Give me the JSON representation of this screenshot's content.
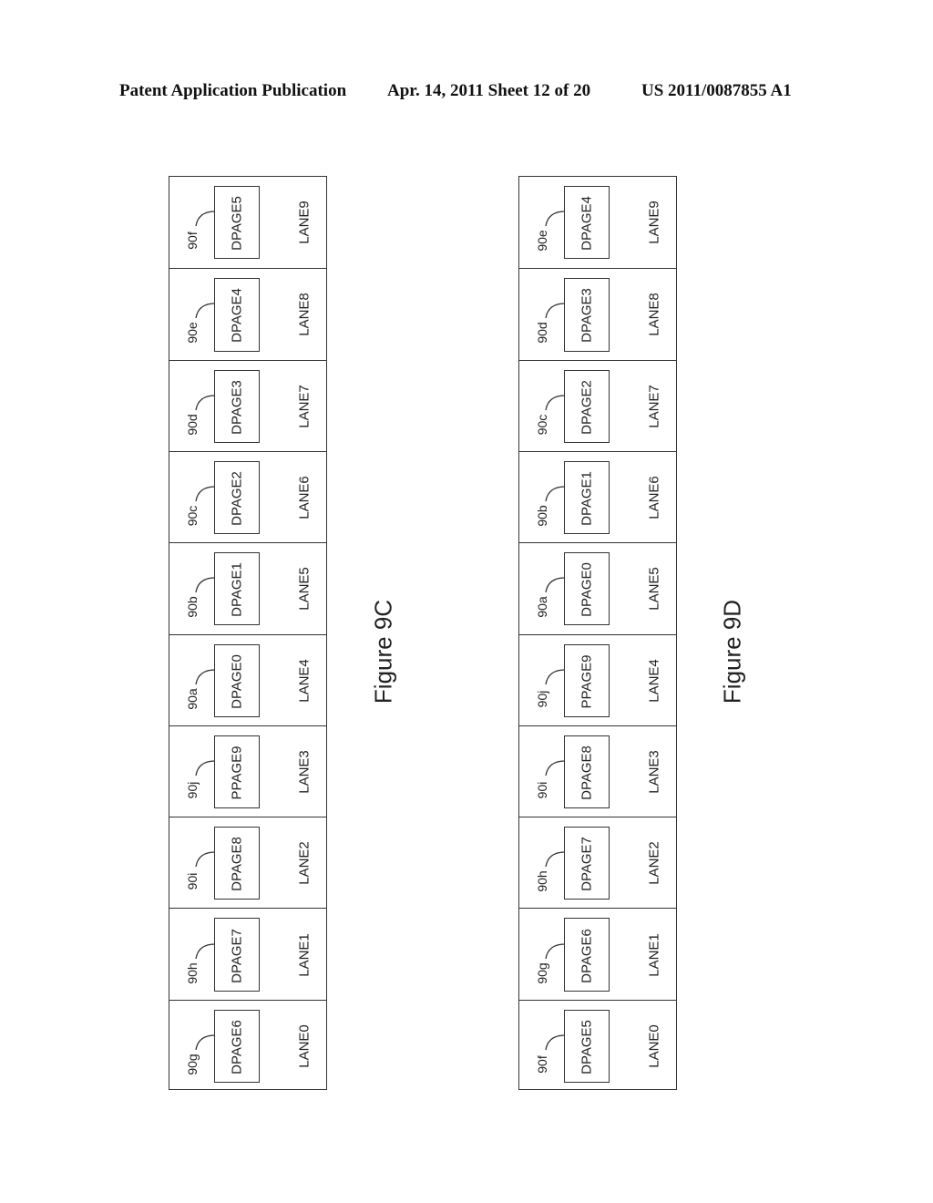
{
  "header": {
    "publication": "Patent Application Publication",
    "date_sheet": "Apr. 14, 2011  Sheet 12 of 20",
    "number": "US 2011/0087855 A1"
  },
  "figures": [
    {
      "caption": "Figure 9C",
      "lanes": [
        {
          "lane": "LANE9",
          "ref": "90f",
          "page": "DPAGE5"
        },
        {
          "lane": "LANE8",
          "ref": "90e",
          "page": "DPAGE4"
        },
        {
          "lane": "LANE7",
          "ref": "90d",
          "page": "DPAGE3"
        },
        {
          "lane": "LANE6",
          "ref": "90c",
          "page": "DPAGE2"
        },
        {
          "lane": "LANE5",
          "ref": "90b",
          "page": "DPAGE1"
        },
        {
          "lane": "LANE4",
          "ref": "90a",
          "page": "DPAGE0"
        },
        {
          "lane": "LANE3",
          "ref": "90j",
          "page": "PPAGE9"
        },
        {
          "lane": "LANE2",
          "ref": "90i",
          "page": "DPAGE8"
        },
        {
          "lane": "LANE1",
          "ref": "90h",
          "page": "DPAGE7"
        },
        {
          "lane": "LANE0",
          "ref": "90g",
          "page": "DPAGE6"
        }
      ]
    },
    {
      "caption": "Figure 9D",
      "lanes": [
        {
          "lane": "LANE9",
          "ref": "90e",
          "page": "DPAGE4"
        },
        {
          "lane": "LANE8",
          "ref": "90d",
          "page": "DPAGE3"
        },
        {
          "lane": "LANE7",
          "ref": "90c",
          "page": "DPAGE2"
        },
        {
          "lane": "LANE6",
          "ref": "90b",
          "page": "DPAGE1"
        },
        {
          "lane": "LANE5",
          "ref": "90a",
          "page": "DPAGE0"
        },
        {
          "lane": "LANE4",
          "ref": "90j",
          "page": "PPAGE9"
        },
        {
          "lane": "LANE3",
          "ref": "90i",
          "page": "DPAGE8"
        },
        {
          "lane": "LANE2",
          "ref": "90h",
          "page": "DPAGE7"
        },
        {
          "lane": "LANE1",
          "ref": "90g",
          "page": "DPAGE6"
        },
        {
          "lane": "LANE0",
          "ref": "90f",
          "page": "DPAGE5"
        }
      ]
    }
  ]
}
